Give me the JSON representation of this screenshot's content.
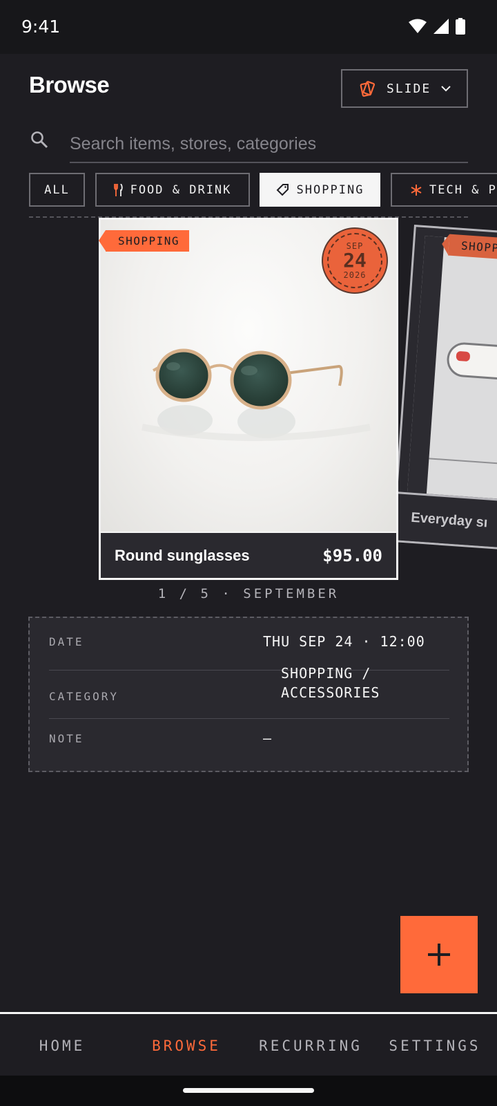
{
  "status_bar": {
    "time": "9:41"
  },
  "header": {
    "title": "Browse",
    "view_mode_label": "SLIDE"
  },
  "search": {
    "placeholder": "Search items, stores, categories",
    "value": ""
  },
  "filters": [
    {
      "label": "ALL",
      "active": false
    },
    {
      "label": "FOOD & DRINK",
      "icon": "fork-knife-icon",
      "active": false
    },
    {
      "label": "SHOPPING",
      "icon": "tag-icon",
      "active": true
    },
    {
      "label": "TECH & PO",
      "icon": "asterisk-icon",
      "active": false
    }
  ],
  "current_card": {
    "category_tag": "SHOPPING",
    "date_stamp": {
      "month": "SEP",
      "day": "24",
      "year": "2026"
    },
    "name": "Round sunglasses",
    "price": "$95.00"
  },
  "next_card": {
    "category_tag": "SHOPPI",
    "name": "Everyday sı"
  },
  "pager": "1 / 5 · SEPTEMBER",
  "details": {
    "date_label": "DATE",
    "date_value": "THU SEP 24 · 12:00",
    "category_label": "CATEGORY",
    "category_value_line1": "SHOPPING /",
    "category_value_line2": "ACCESSORIES",
    "note_label": "NOTE",
    "note_value": "—"
  },
  "fab": {
    "icon": "plus-icon"
  },
  "nav": [
    {
      "label": "HOME",
      "active": false
    },
    {
      "label": "BROWSE",
      "active": true
    },
    {
      "label": "RECURRING",
      "active": false
    },
    {
      "label": "SETTINGS",
      "active": false
    }
  ],
  "colors": {
    "accent": "#ff6a3a",
    "background": "#1e1d22",
    "surface": "#2a292f"
  }
}
